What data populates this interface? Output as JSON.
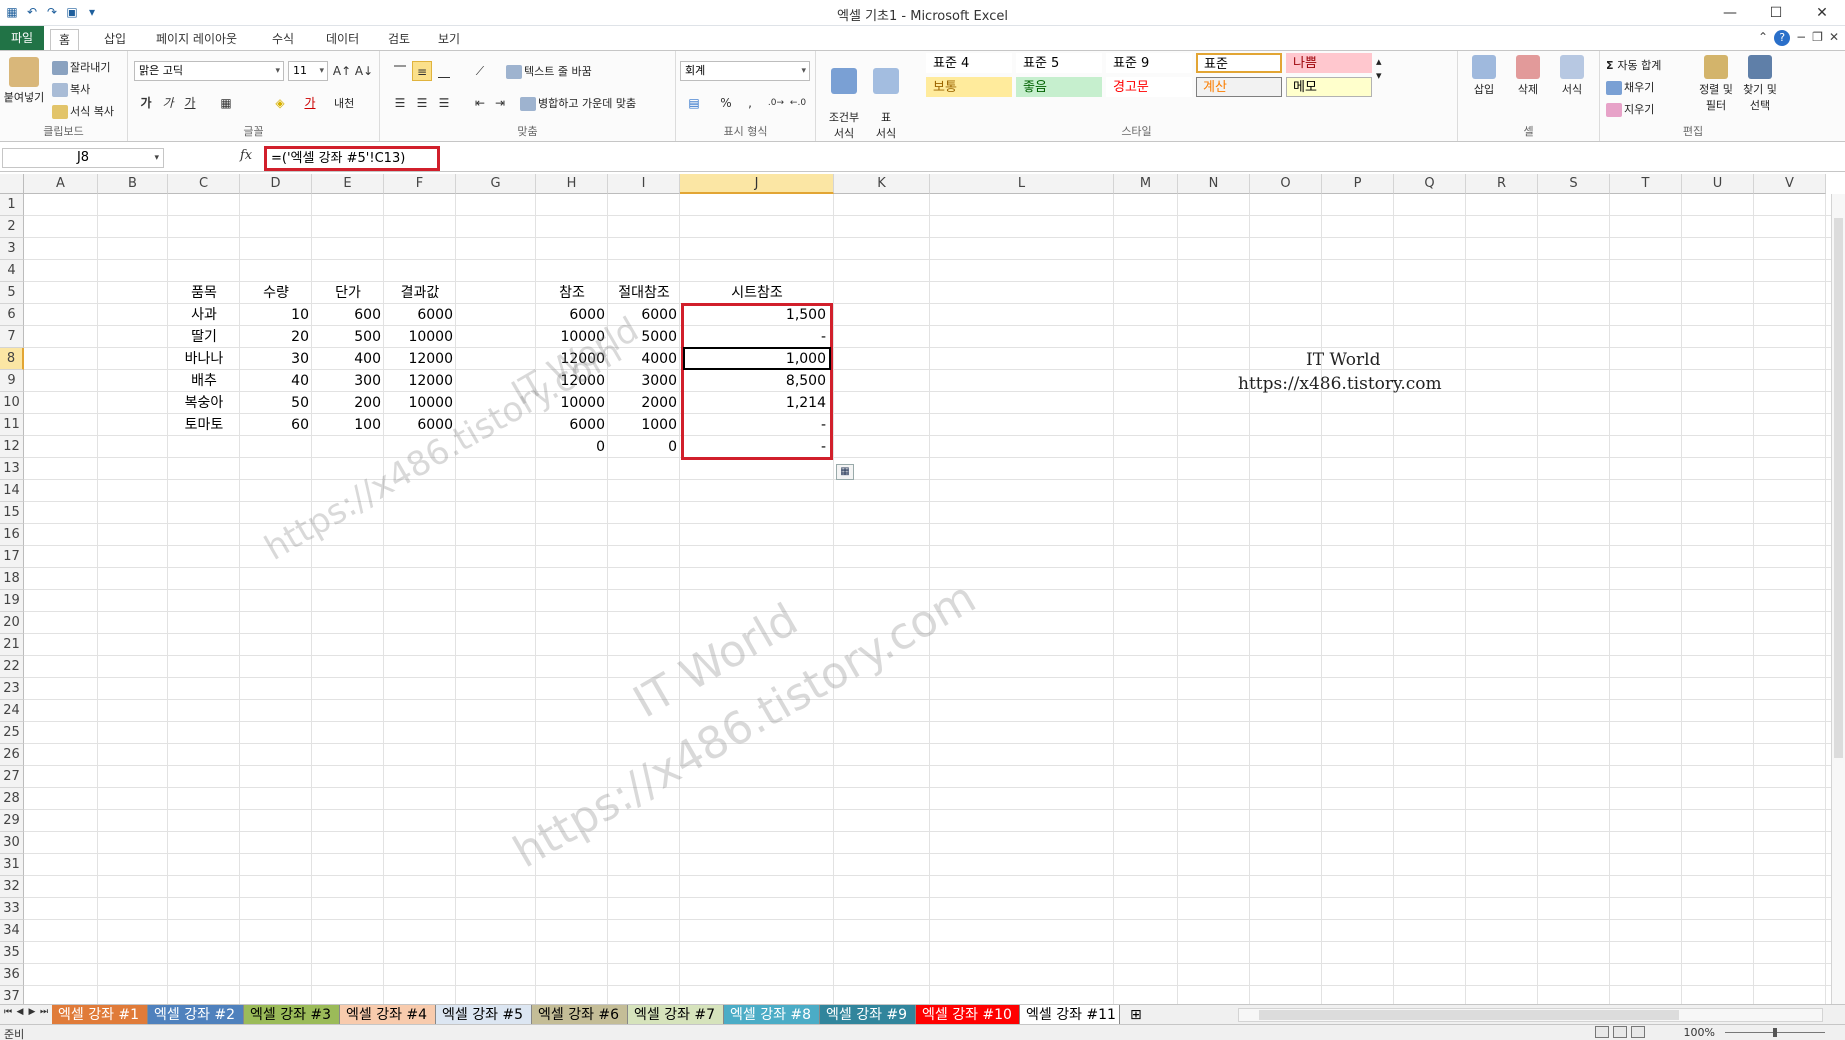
{
  "window": {
    "title": "엑셀 기초1 - Microsoft Excel",
    "minimize": "—",
    "maximize": "☐",
    "close": "✕"
  },
  "qat": [
    "save-icon",
    "undo-icon",
    "redo-icon"
  ],
  "ribbon_tabs": {
    "file": "파일",
    "home": "홈",
    "insert": "삽입",
    "layout": "페이지 레이아웃",
    "formulas": "수식",
    "data": "데이터",
    "review": "검토",
    "view": "보기"
  },
  "clipboard": {
    "paste": "붙여넣기",
    "cut": "잘라내기",
    "copy": "복사",
    "format_painter": "서식 복사",
    "label": "클립보드"
  },
  "font": {
    "name": "맑은 고딕",
    "size": "11",
    "bold": "가",
    "italic": "가",
    "underline": "가",
    "phonetic": "내천",
    "label": "글꼴"
  },
  "alignment": {
    "wrap_text": "텍스트 줄 바꿈",
    "merge_center": "병합하고 가운데 맞춤",
    "label": "맞춤"
  },
  "number": {
    "format": "회계",
    "percent": "%",
    "comma": ",",
    "label": "표시 형식"
  },
  "styles": {
    "conditional": "조건부\n서식",
    "table": "표\n서식",
    "cells": [
      {
        "name": "표준 4",
        "color": "#ffffff",
        "text": "#000000"
      },
      {
        "name": "표준 5",
        "color": "#ffffff",
        "text": "#000000"
      },
      {
        "name": "표준 9",
        "color": "#ffffff",
        "text": "#000000"
      },
      {
        "name": "표준",
        "color": "#ffffff",
        "text": "#000000"
      },
      {
        "name": "나쁨",
        "color": "#ffc7ce",
        "text": "#9c0006"
      },
      {
        "name": "보통",
        "color": "#ffeb9c",
        "text": "#9c6500"
      },
      {
        "name": "좋음",
        "color": "#c6efce",
        "text": "#006100"
      },
      {
        "name": "경고문",
        "color": "#ffffff",
        "text": "#ff0000"
      },
      {
        "name": "계산",
        "color": "#f2f2f2",
        "text": "#fa7d00"
      },
      {
        "name": "메모",
        "color": "#ffffcc",
        "text": "#000000"
      }
    ],
    "label": "스타일"
  },
  "cells_group": {
    "insert": "삽입",
    "delete": "삭제",
    "format": "서식",
    "label": "셀"
  },
  "editing": {
    "autosum": "자동 합계",
    "fill": "채우기",
    "clear": "지우기",
    "sort_filter": "정렬 및\n필터",
    "find_select": "찾기 및\n선택",
    "label": "편집"
  },
  "formula_bar": {
    "name_box": "J8",
    "fx": "fx",
    "formula": "=('엑셀 강좌 #5'!C13)"
  },
  "columns": [
    "A",
    "B",
    "C",
    "D",
    "E",
    "F",
    "G",
    "H",
    "I",
    "J",
    "K",
    "L",
    "M",
    "N",
    "O",
    "P",
    "Q",
    "R",
    "S",
    "T",
    "U",
    "V"
  ],
  "rows": [
    "1",
    "2",
    "3",
    "4",
    "5",
    "6",
    "7",
    "8",
    "9",
    "10",
    "11",
    "12",
    "13",
    "14",
    "15",
    "16",
    "17",
    "18",
    "19",
    "20",
    "21",
    "22",
    "23",
    "24",
    "25",
    "26",
    "27",
    "28",
    "29",
    "30",
    "31",
    "32",
    "33",
    "34",
    "35",
    "36",
    "37"
  ],
  "sheet": {
    "headers": {
      "item": "품목",
      "qty": "수량",
      "price": "단가",
      "result": "결과값",
      "ref": "참조",
      "absref": "절대참조",
      "sheetref": "시트참조"
    },
    "rows": [
      {
        "item": "사과",
        "qty": "10",
        "price": "600",
        "result": "6000",
        "ref": "6000",
        "absref": "6000",
        "sheetref": "1,500"
      },
      {
        "item": "딸기",
        "qty": "20",
        "price": "500",
        "result": "10000",
        "ref": "10000",
        "absref": "5000",
        "sheetref": "-"
      },
      {
        "item": "바나나",
        "qty": "30",
        "price": "400",
        "result": "12000",
        "ref": "12000",
        "absref": "4000",
        "sheetref": "1,000"
      },
      {
        "item": "배추",
        "qty": "40",
        "price": "300",
        "result": "12000",
        "ref": "12000",
        "absref": "3000",
        "sheetref": "8,500"
      },
      {
        "item": "복숭아",
        "qty": "50",
        "price": "200",
        "result": "10000",
        "ref": "10000",
        "absref": "2000",
        "sheetref": "1,214"
      },
      {
        "item": "토마토",
        "qty": "60",
        "price": "100",
        "result": "6000",
        "ref": "6000",
        "absref": "1000",
        "sheetref": "-"
      },
      {
        "item": "",
        "qty": "",
        "price": "",
        "result": "",
        "ref": "0",
        "absref": "0",
        "sheetref": "-"
      }
    ],
    "note_title": "IT World",
    "note_url": "https://x486.tistory.com"
  },
  "watermarks": [
    {
      "title": "IT World",
      "url": "https://x486.tistory.com"
    },
    {
      "title": "IT World",
      "url": "https://x486.tistory.com"
    }
  ],
  "sheet_tabs": [
    {
      "name": "엑셀 강좌 #1",
      "color": "#e07b39"
    },
    {
      "name": "엑셀 강좌 #2",
      "color": "#4f81bd"
    },
    {
      "name": "엑셀 강좌 #3",
      "color": "#9bbb59"
    },
    {
      "name": "엑셀 강좌 #4",
      "color": "#f8cbad"
    },
    {
      "name": "엑셀 강좌 #5",
      "color": "#dce6f2"
    },
    {
      "name": "엑셀 강좌 #6",
      "color": "#c4bd97"
    },
    {
      "name": "엑셀 강좌 #7",
      "color": "#d6e3bc"
    },
    {
      "name": "엑셀 강좌 #8",
      "color": "#4bacc6"
    },
    {
      "name": "엑셀 강좌 #9",
      "color": "#31859c"
    },
    {
      "name": "엑셀 강좌 #10",
      "color": "#ff0000"
    },
    {
      "name": "엑셀 강좌 #11",
      "color": "#ffffff"
    }
  ],
  "status": {
    "ready": "준비",
    "zoom": "100%"
  }
}
